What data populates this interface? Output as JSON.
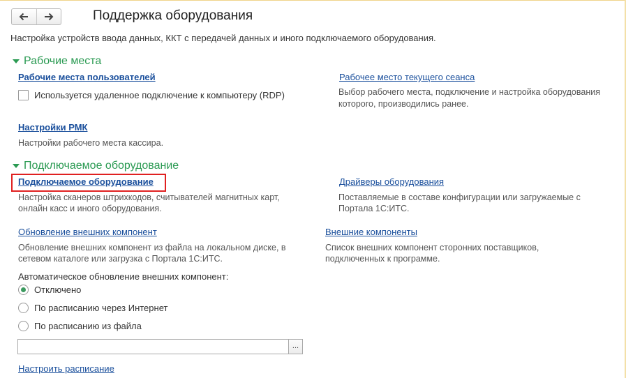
{
  "window": {
    "title": "Поддержка оборудования"
  },
  "header": {
    "back_icon": "arrow-left-icon",
    "forward_icon": "arrow-right-icon",
    "subtitle": "Настройка устройств ввода данных, ККТ с передачей данных и иного подключаемого оборудования."
  },
  "workplaces": {
    "heading": "Рабочие места",
    "user_workplaces": {
      "label": "Рабочие места пользователей"
    },
    "rdp": {
      "label": "Используется удаленное подключение к компьютеру (RDP)",
      "checked": false
    },
    "current_session": {
      "label": "Рабочее место текущего сеанса",
      "desc_line1": "Выбор рабочего места, подключение и настройка оборудования",
      "desc_line2": "которого, производились ранее."
    },
    "rmk": {
      "label": "Настройки РМК",
      "desc": "Настройки рабочего места кассира."
    }
  },
  "equipment": {
    "heading": "Подключаемое оборудование",
    "connected": {
      "label": "Подключаемое оборудование",
      "desc_line1": "Настройка сканеров штрихкодов, считывателей магнитных карт,",
      "desc_line2": "онлайн касс и иного оборудования."
    },
    "drivers": {
      "label": "Драйверы оборудования",
      "desc_line1": "Поставляемые в составе конфигурации или загружаемые с",
      "desc_line2": "Портала 1С:ИТС."
    },
    "update_components": {
      "label": "Обновление внешних компонент",
      "desc_line1": "Обновление внешних компонент из файла на локальном диске, в",
      "desc_line2": "сетевом каталоге или загрузка с Портала 1С:ИТС."
    },
    "external_components": {
      "label": "Внешние компоненты",
      "desc_line1": "Список внешних компонент сторонних поставщиков,",
      "desc_line2": "подключенных к программе."
    },
    "auto_update": {
      "label": "Автоматическое обновление внешних компонент:",
      "options": [
        "Отключено",
        "По расписанию через Интернет",
        "По расписанию из файла"
      ],
      "selected": "Отключено"
    },
    "file_path": {
      "value": "",
      "picker_label": "..."
    },
    "schedule_link": "Настроить расписание"
  },
  "colors": {
    "section": "#2a9a52",
    "link": "#1a4f9c",
    "highlight": "#e02020"
  }
}
